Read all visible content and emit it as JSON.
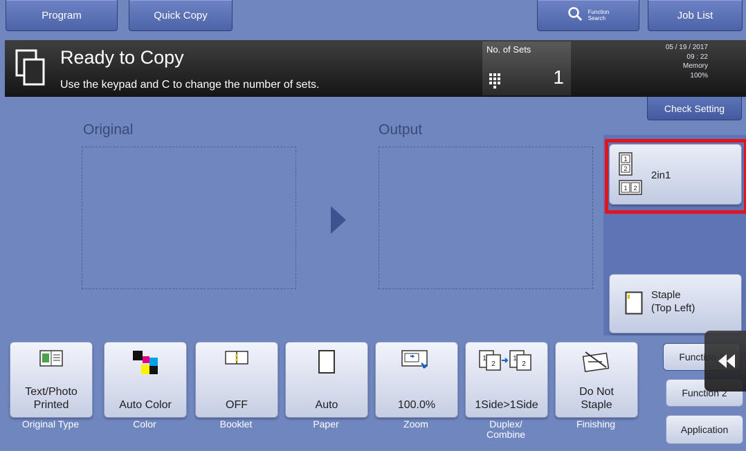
{
  "top_tabs": {
    "program": "Program",
    "quick_copy": "Quick Copy",
    "function_search_line1": "Function",
    "function_search_line2": "Search",
    "job_list": "Job List"
  },
  "status": {
    "title": "Ready to Copy",
    "subtitle": "Use the keypad and C to change the number of sets.",
    "sets_label": "No. of Sets",
    "sets_value": "1",
    "date": "05 / 19 / 2017",
    "time": "09 : 22",
    "memory_label": "Memory",
    "memory_value": "100%"
  },
  "check_setting": "Check Setting",
  "preview": {
    "original_label": "Original",
    "output_label": "Output"
  },
  "right_panel": {
    "two_in_one_label": "2in1",
    "staple_line1": "Staple",
    "staple_line2": "(Top Left)"
  },
  "function_keys": [
    {
      "value_line1": "Text/Photo",
      "value_line2": "Printed",
      "label": "Original Type"
    },
    {
      "value_line1": "Auto Color",
      "value_line2": "",
      "label": "Color"
    },
    {
      "value_line1": "OFF",
      "value_line2": "",
      "label": "Booklet"
    },
    {
      "value_line1": "Auto",
      "value_line2": "",
      "label": "Paper"
    },
    {
      "value_line1": "100.0%",
      "value_line2": "",
      "label": "Zoom"
    },
    {
      "value_line1": "1Side>1Side",
      "value_line2": "",
      "label_line1": "Duplex/",
      "label_line2": "Combine"
    },
    {
      "value_line1": "Do Not",
      "value_line2": "Staple",
      "label": "Finishing"
    }
  ],
  "side_tabs": {
    "function1": "Function 1",
    "function2": "Function 2",
    "application": "Application"
  },
  "colors": {
    "background": "#6f86bf",
    "highlight": "#e4141c",
    "status_bar": "#1e1e1e"
  }
}
